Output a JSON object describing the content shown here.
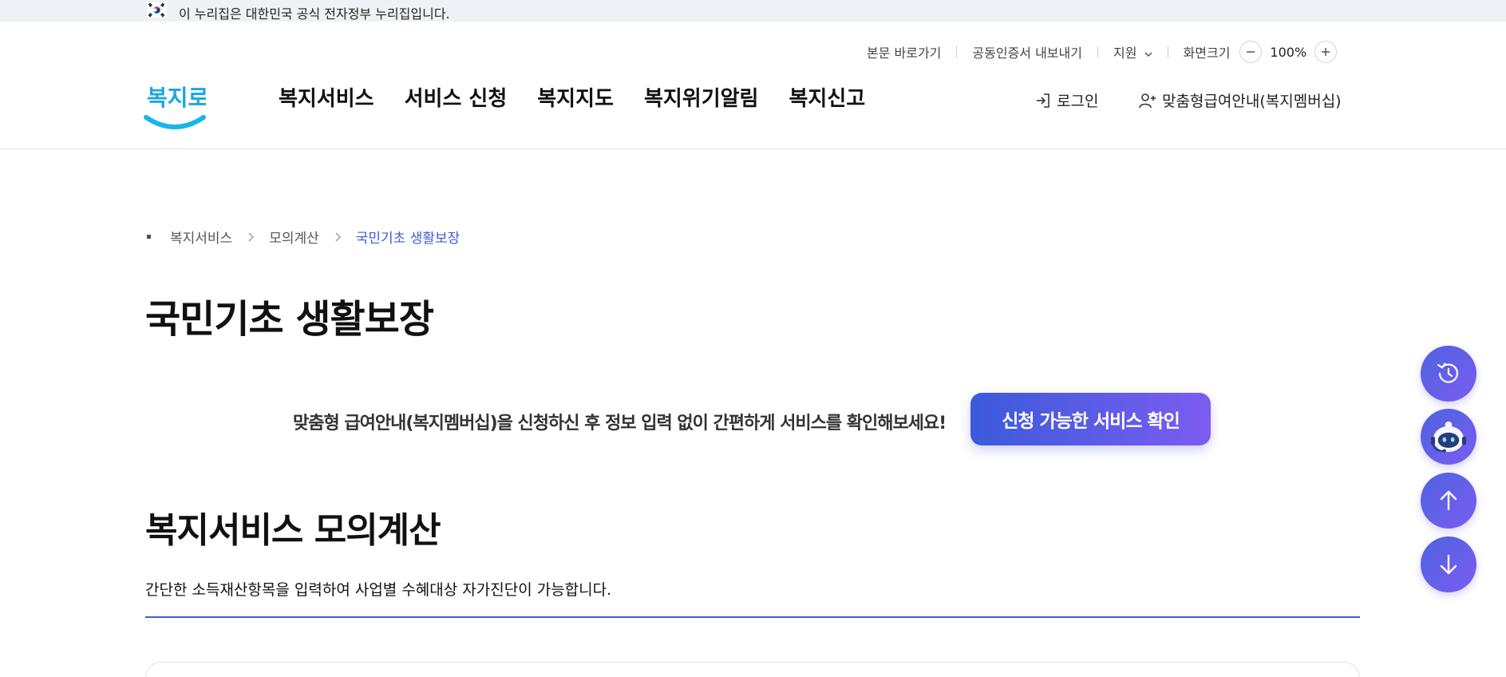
{
  "gov_banner": {
    "text": "이 누리집은 대한민국 공식 전자정부 누리집입니다.",
    "flag_icon": "korea-flag-icon"
  },
  "utility": {
    "skip_to_content": "본문 바로가기",
    "export_certificate": "공동인증서 내보내기",
    "support": "지원",
    "screen_size_label": "화면크기",
    "zoom_value": "100%"
  },
  "logo": {
    "text": "복지로"
  },
  "gnb": {
    "menus": [
      "복지서비스",
      "서비스 신청",
      "복지지도",
      "복지위기알림",
      "복지신고"
    ]
  },
  "account": {
    "login": "로그인",
    "membership": "맞춤형급여안내(복지멤버십)"
  },
  "breadcrumb": {
    "items": [
      "복지서비스",
      "모의계산",
      "국민기초 생활보장"
    ]
  },
  "page_title": "국민기초 생활보장",
  "promo": {
    "text": "맞춤형 급여안내(복지멤버십)을 신청하신 후 정보 입력 없이 간편하게 서비스를 확인해보세요!",
    "button": "신청 가능한 서비스 확인"
  },
  "section": {
    "title": "복지서비스 모의계산",
    "description": "간단한 소득재산항목을 입력하여 사업별 수혜대상 자가진단이 가능합니다."
  },
  "floating_buttons": [
    "history-icon",
    "chatbot-icon",
    "arrow-up-icon",
    "arrow-down-icon"
  ],
  "colors": {
    "accent": "#3d5bd9",
    "gradient_start": "#3a5bdb",
    "gradient_end": "#7c5cf0",
    "logo_blue": "#1aa5e6"
  }
}
